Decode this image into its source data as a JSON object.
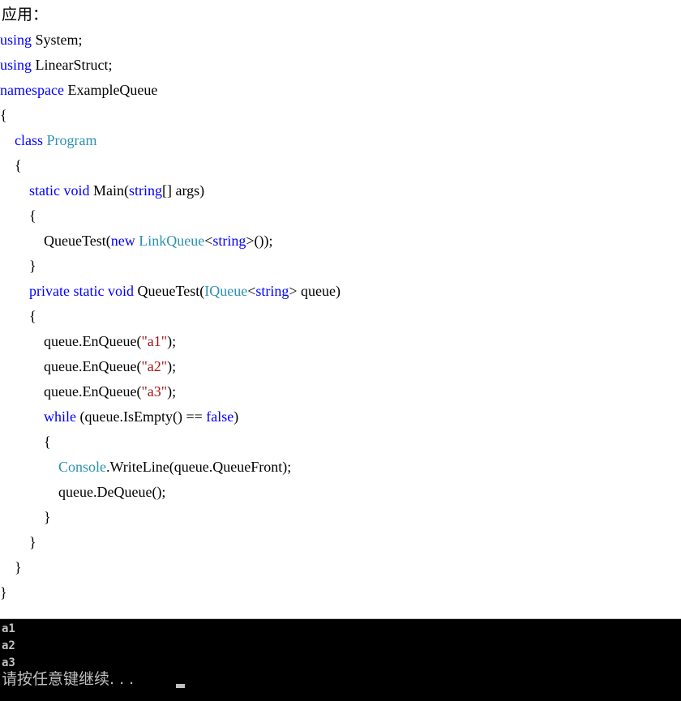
{
  "heading": "应用：",
  "code": {
    "lines": [
      [
        {
          "t": "using",
          "c": "kw"
        },
        {
          "t": " System;",
          "c": "plain"
        }
      ],
      [
        {
          "t": "using",
          "c": "kw"
        },
        {
          "t": " LinearStruct;",
          "c": "plain"
        }
      ],
      [
        {
          "t": "namespace",
          "c": "kw"
        },
        {
          "t": " ExampleQueue",
          "c": "plain"
        }
      ],
      [
        {
          "t": "{",
          "c": "plain"
        }
      ],
      [
        {
          "t": "    ",
          "c": "plain"
        },
        {
          "t": "class",
          "c": "kw"
        },
        {
          "t": " ",
          "c": "plain"
        },
        {
          "t": "Program",
          "c": "type"
        }
      ],
      [
        {
          "t": "    {",
          "c": "plain"
        }
      ],
      [
        {
          "t": "        ",
          "c": "plain"
        },
        {
          "t": "static",
          "c": "kw"
        },
        {
          "t": " ",
          "c": "plain"
        },
        {
          "t": "void",
          "c": "kw"
        },
        {
          "t": " Main(",
          "c": "plain"
        },
        {
          "t": "string",
          "c": "kw"
        },
        {
          "t": "[] args)",
          "c": "plain"
        }
      ],
      [
        {
          "t": "        {",
          "c": "plain"
        }
      ],
      [
        {
          "t": "            QueueTest(",
          "c": "plain"
        },
        {
          "t": "new",
          "c": "kw"
        },
        {
          "t": " ",
          "c": "plain"
        },
        {
          "t": "LinkQueue",
          "c": "type"
        },
        {
          "t": "<",
          "c": "plain"
        },
        {
          "t": "string",
          "c": "kw"
        },
        {
          "t": ">());",
          "c": "plain"
        }
      ],
      [
        {
          "t": "        }",
          "c": "plain"
        }
      ],
      [
        {
          "t": "        ",
          "c": "plain"
        },
        {
          "t": "private",
          "c": "kw"
        },
        {
          "t": " ",
          "c": "plain"
        },
        {
          "t": "static",
          "c": "kw"
        },
        {
          "t": " ",
          "c": "plain"
        },
        {
          "t": "void",
          "c": "kw"
        },
        {
          "t": " QueueTest(",
          "c": "plain"
        },
        {
          "t": "IQueue",
          "c": "type"
        },
        {
          "t": "<",
          "c": "plain"
        },
        {
          "t": "string",
          "c": "kw"
        },
        {
          "t": "> queue)",
          "c": "plain"
        }
      ],
      [
        {
          "t": "        {",
          "c": "plain"
        }
      ],
      [
        {
          "t": "            queue.EnQueue(",
          "c": "plain"
        },
        {
          "t": "\"a1\"",
          "c": "str"
        },
        {
          "t": ");",
          "c": "plain"
        }
      ],
      [
        {
          "t": "            queue.EnQueue(",
          "c": "plain"
        },
        {
          "t": "\"a2\"",
          "c": "str"
        },
        {
          "t": ");",
          "c": "plain"
        }
      ],
      [
        {
          "t": "            queue.EnQueue(",
          "c": "plain"
        },
        {
          "t": "\"a3\"",
          "c": "str"
        },
        {
          "t": ");",
          "c": "plain"
        }
      ],
      [
        {
          "t": "            ",
          "c": "plain"
        },
        {
          "t": "while",
          "c": "kw"
        },
        {
          "t": " (queue.IsEmpty() == ",
          "c": "plain"
        },
        {
          "t": "false",
          "c": "kw"
        },
        {
          "t": ")",
          "c": "plain"
        }
      ],
      [
        {
          "t": "            {",
          "c": "plain"
        }
      ],
      [
        {
          "t": "                ",
          "c": "plain"
        },
        {
          "t": "Console",
          "c": "type"
        },
        {
          "t": ".WriteLine(queue.QueueFront);",
          "c": "plain"
        }
      ],
      [
        {
          "t": "                queue.DeQueue();",
          "c": "plain"
        }
      ],
      [
        {
          "t": "            }",
          "c": "plain"
        }
      ],
      [
        {
          "t": "        }",
          "c": "plain"
        }
      ],
      [
        {
          "t": "    }",
          "c": "plain"
        }
      ],
      [
        {
          "t": "}",
          "c": "plain"
        }
      ]
    ]
  },
  "console": {
    "output": [
      "a1",
      "a2",
      "a3"
    ],
    "prompt": "请按任意键继续. . ."
  }
}
